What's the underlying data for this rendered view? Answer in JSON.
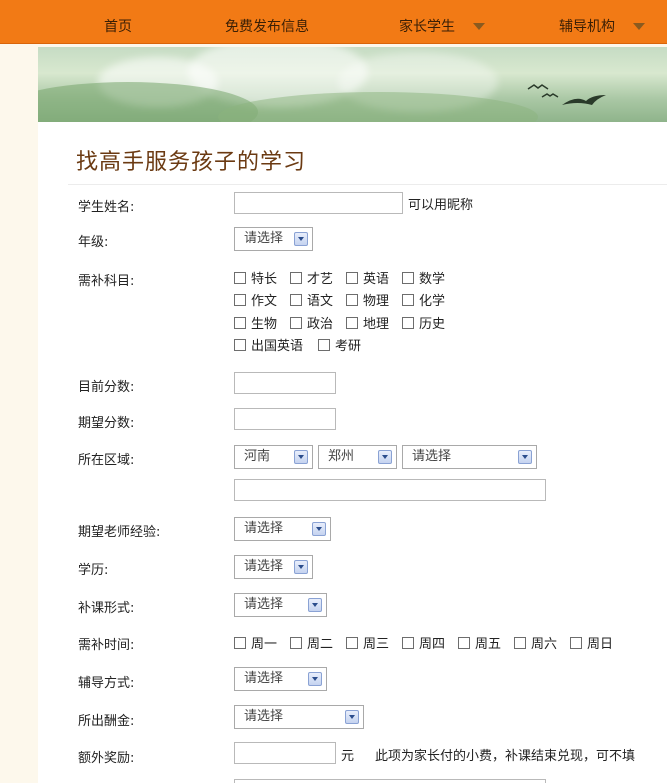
{
  "nav": {
    "home": "首页",
    "post": "免费发布信息",
    "parents": "家长学生",
    "tutors": "辅导机构"
  },
  "form": {
    "title": "找高手服务孩子的学习",
    "name": {
      "label": "学生姓名:",
      "hint": "可以用昵称",
      "value": ""
    },
    "grade": {
      "label": "年级:",
      "selected": "请选择"
    },
    "subjects": {
      "label": "需补科目:",
      "options": [
        "特长",
        "才艺",
        "英语",
        "数学",
        "作文",
        "语文",
        "物理",
        "化学",
        "生物",
        "政治",
        "地理",
        "历史",
        "出国英语",
        "考研"
      ]
    },
    "current_score": {
      "label": "目前分数:",
      "value": ""
    },
    "target_score": {
      "label": "期望分数:",
      "value": ""
    },
    "region": {
      "label": "所在区域:",
      "province": "河南",
      "city": "郑州",
      "district": "请选择",
      "address": ""
    },
    "experience": {
      "label": "期望老师经验:",
      "selected": "请选择"
    },
    "education": {
      "label": "学历:",
      "selected": "请选择"
    },
    "lesson_form": {
      "label": "补课形式:",
      "selected": "请选择"
    },
    "time": {
      "label": "需补时间:",
      "options": [
        "周一",
        "周二",
        "周三",
        "周四",
        "周五",
        "周六",
        "周日"
      ]
    },
    "method": {
      "label": "辅导方式:",
      "selected": "请选择"
    },
    "pay": {
      "label": "所出酬金:",
      "selected": "请选择"
    },
    "bonus": {
      "label": "额外奖励:",
      "unit": "元",
      "note": "此项为家长付的小费，补课结束兑现，可不填",
      "value": ""
    }
  }
}
